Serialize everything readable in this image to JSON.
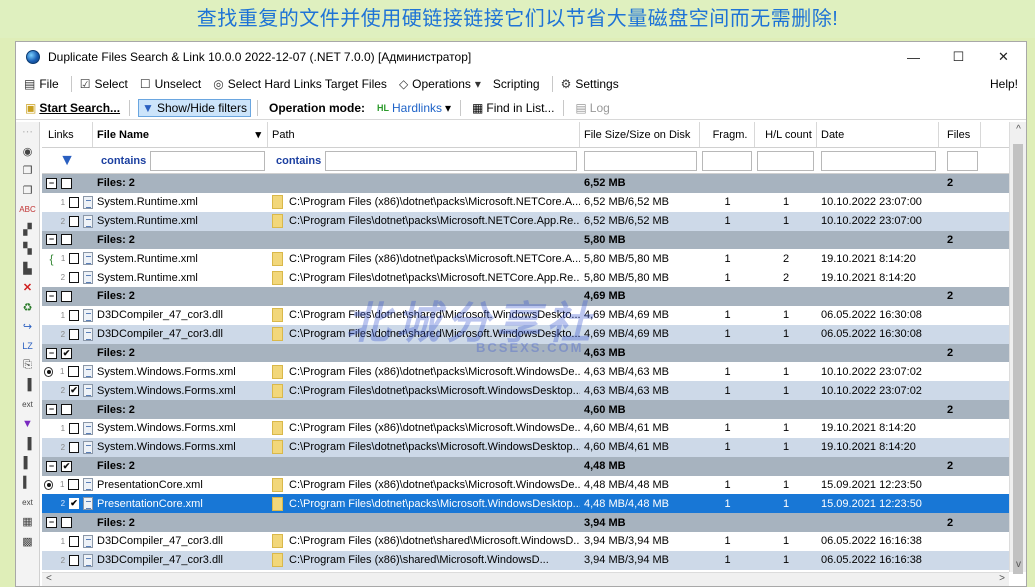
{
  "banner": "查找重复的文件并使用硬链接链接它们以节省大量磁盘空间而无需删除!",
  "window": {
    "title": "Duplicate Files Search & Link 10.0.0 2022-12-07 (.NET 7.0.0) [Администратор]",
    "minimize": "—",
    "maximize": "☐",
    "close": "✕"
  },
  "menu": {
    "file": "File",
    "select": "Select",
    "unselect": "Unselect",
    "select_hl": "Select Hard Links Target Files",
    "operations": "Operations",
    "scripting": "Scripting",
    "settings": "Settings",
    "help": "Help!"
  },
  "toolbar": {
    "start": "Start Search...",
    "filters": "Show/Hide filters",
    "opmode": "Operation mode:",
    "hardlinks": "Hardlinks",
    "find": "Find in List...",
    "log": "Log"
  },
  "columns": {
    "links": "Links",
    "name": "File Name",
    "path": "Path",
    "size": "File Size/Size on Disk",
    "fragm": "Fragm.",
    "hl_count": "H/L count",
    "date": "Date",
    "files": "Files"
  },
  "filter": {
    "name": "contains",
    "path": "contains"
  },
  "rows": [
    {
      "type": "group",
      "name": "Files: 2",
      "size": "6,52 MB",
      "files": "2"
    },
    {
      "type": "file",
      "style": "odd",
      "num": "1",
      "check": "",
      "name": "System.Runtime.xml",
      "path": "C:\\Program Files (x86)\\dotnet\\packs\\Microsoft.NETCore.A...",
      "size": "6,52 MB/6,52 MB",
      "fragm": "1",
      "hl": "1",
      "date": "10.10.2022 23:07:00"
    },
    {
      "type": "file",
      "style": "even",
      "num": "2",
      "check": "",
      "name": "System.Runtime.xml",
      "path": "C:\\Program Files\\dotnet\\packs\\Microsoft.NETCore.App.Re...",
      "size": "6,52 MB/6,52 MB",
      "fragm": "1",
      "hl": "1",
      "date": "10.10.2022 23:07:00"
    },
    {
      "type": "group",
      "name": "Files: 2",
      "size": "5,80 MB",
      "files": "2"
    },
    {
      "type": "file",
      "style": "odd",
      "num": "1",
      "brace": "{",
      "check": "",
      "name": "System.Runtime.xml",
      "path": "C:\\Program Files (x86)\\dotnet\\packs\\Microsoft.NETCore.A...",
      "size": "5,80 MB/5,80 MB",
      "fragm": "1",
      "hl": "2",
      "date": "19.10.2021 8:14:20"
    },
    {
      "type": "file",
      "style": "odd",
      "num": "2",
      "check": "",
      "name": "System.Runtime.xml",
      "path": "C:\\Program Files\\dotnet\\packs\\Microsoft.NETCore.App.Re...",
      "size": "5,80 MB/5,80 MB",
      "fragm": "1",
      "hl": "2",
      "date": "19.10.2021 8:14:20"
    },
    {
      "type": "group",
      "name": "Files: 2",
      "size": "4,69 MB",
      "files": "2"
    },
    {
      "type": "file",
      "style": "odd",
      "num": "1",
      "check": "",
      "name": "D3DCompiler_47_cor3.dll",
      "path": "C:\\Program Files\\dotnet\\shared\\Microsoft.WindowsDeskto...",
      "size": "4,69 MB/4,69 MB",
      "fragm": "1",
      "hl": "1",
      "date": "06.05.2022 16:30:08"
    },
    {
      "type": "file",
      "style": "even",
      "num": "2",
      "check": "",
      "name": "D3DCompiler_47_cor3.dll",
      "path": "C:\\Program Files\\dotnet\\shared\\Microsoft.WindowsDeskto...",
      "size": "4,69 MB/4,69 MB",
      "fragm": "1",
      "hl": "1",
      "date": "06.05.2022 16:30:08"
    },
    {
      "type": "group",
      "name": "Files: 2",
      "size": "4,63 MB",
      "files": "2",
      "checked": true
    },
    {
      "type": "file",
      "style": "odd",
      "num": "1",
      "radio": true,
      "check": "",
      "name": "System.Windows.Forms.xml",
      "path": "C:\\Program Files (x86)\\dotnet\\packs\\Microsoft.WindowsDe...",
      "size": "4,63 MB/4,63 MB",
      "fragm": "1",
      "hl": "1",
      "date": "10.10.2022 23:07:02"
    },
    {
      "type": "file",
      "style": "even",
      "num": "2",
      "check": "✔",
      "name": "System.Windows.Forms.xml",
      "path": "C:\\Program Files\\dotnet\\packs\\Microsoft.WindowsDesktop...",
      "size": "4,63 MB/4,63 MB",
      "fragm": "1",
      "hl": "1",
      "date": "10.10.2022 23:07:02"
    },
    {
      "type": "group",
      "name": "Files: 2",
      "size": "4,60 MB",
      "files": "2"
    },
    {
      "type": "file",
      "style": "odd",
      "num": "1",
      "check": "",
      "name": "System.Windows.Forms.xml",
      "path": "C:\\Program Files (x86)\\dotnet\\packs\\Microsoft.WindowsDe...",
      "size": "4,60 MB/4,61 MB",
      "fragm": "1",
      "hl": "1",
      "date": "19.10.2021 8:14:20"
    },
    {
      "type": "file",
      "style": "even",
      "num": "2",
      "check": "",
      "name": "System.Windows.Forms.xml",
      "path": "C:\\Program Files\\dotnet\\packs\\Microsoft.WindowsDesktop...",
      "size": "4,60 MB/4,61 MB",
      "fragm": "1",
      "hl": "1",
      "date": "19.10.2021 8:14:20"
    },
    {
      "type": "group",
      "name": "Files: 2",
      "size": "4,48 MB",
      "files": "2",
      "checked": true
    },
    {
      "type": "file",
      "style": "odd",
      "num": "1",
      "radio": true,
      "check": "",
      "name": "PresentationCore.xml",
      "path": "C:\\Program Files (x86)\\dotnet\\packs\\Microsoft.WindowsDe...",
      "size": "4,48 MB/4,48 MB",
      "fragm": "1",
      "hl": "1",
      "date": "15.09.2021 12:23:50"
    },
    {
      "type": "file",
      "style": "sel",
      "num": "2",
      "check": "✔",
      "name": "PresentationCore.xml",
      "path": "C:\\Program Files\\dotnet\\packs\\Microsoft.WindowsDesktop...",
      "size": "4,48 MB/4,48 MB",
      "fragm": "1",
      "hl": "1",
      "date": "15.09.2021 12:23:50"
    },
    {
      "type": "group",
      "name": "Files: 2",
      "size": "3,94 MB",
      "files": "2"
    },
    {
      "type": "file",
      "style": "odd",
      "num": "1",
      "check": "",
      "name": "D3DCompiler_47_cor3.dll",
      "path": "C:\\Program Files (x86)\\dotnet\\shared\\Microsoft.WindowsD...",
      "size": "3,94 MB/3,94 MB",
      "fragm": "1",
      "hl": "1",
      "date": "06.05.2022 16:16:38"
    },
    {
      "type": "file",
      "style": "even",
      "num": "2",
      "check": "",
      "name": "D3DCompiler_47_cor3.dll",
      "path": "C:\\Program Files (x86)\\shared\\Microsoft.WindowsD...",
      "size": "3,94 MB/3,94 MB",
      "fragm": "1",
      "hl": "1",
      "date": "06.05.2022 16:16:38"
    }
  ],
  "watermark": {
    "main": "北城分享社",
    "sub": "BCSEXS.COM"
  },
  "scroll": {
    "up": "^",
    "down": "v",
    "left": "<",
    "right": ">"
  }
}
